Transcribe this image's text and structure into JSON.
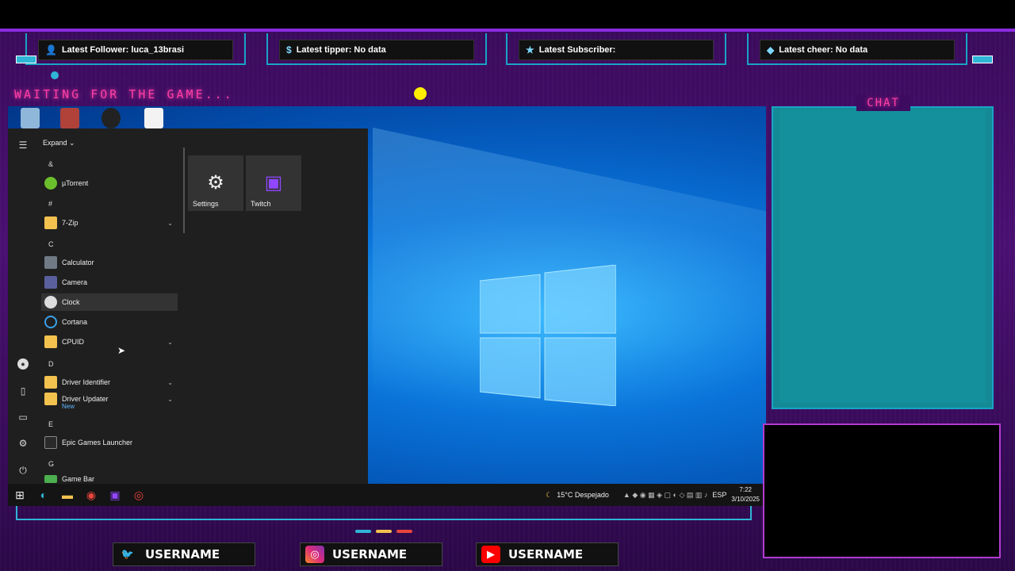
{
  "alerts": {
    "follower": "Latest Follower: luca_13brasi",
    "tipper": "Latest tipper: No data",
    "subscriber": "Latest Subscriber:",
    "cheer": "Latest cheer: No data"
  },
  "overlay": {
    "waiting_text": "WAITING FOR THE GAME...",
    "chat_title": "CHAT"
  },
  "start_menu": {
    "expand_label": "Expand",
    "sections": [
      {
        "letter": "&"
      },
      {
        "letter": "#"
      },
      {
        "letter": "C"
      },
      {
        "letter": "D"
      },
      {
        "letter": "E"
      },
      {
        "letter": "G"
      }
    ],
    "apps": [
      {
        "label": "µTorrent"
      },
      {
        "label": "7-Zip"
      },
      {
        "label": "Calculator"
      },
      {
        "label": "Camera"
      },
      {
        "label": "Clock"
      },
      {
        "label": "Cortana"
      },
      {
        "label": "CPUID"
      },
      {
        "label": "Driver Identifier"
      },
      {
        "label": "Driver Updater",
        "badge": "New"
      },
      {
        "label": "Epic Games Launcher"
      },
      {
        "label": "Game Bar"
      }
    ],
    "tiles": [
      {
        "label": "Settings",
        "icon": "gear-icon"
      },
      {
        "label": "Twitch",
        "icon": "twitch-icon"
      }
    ]
  },
  "taskbar": {
    "weather": "15°C  Despejado",
    "language": "ESP",
    "time": "7:22",
    "date": "3/10/2025"
  },
  "socials": [
    {
      "platform": "twitter",
      "username": "USERNAME"
    },
    {
      "platform": "instagram",
      "username": "USERNAME"
    },
    {
      "platform": "youtube",
      "username": "USERNAME"
    }
  ],
  "colors": {
    "accent_pink": "#ff3ea5",
    "accent_cyan": "#1aa3c6",
    "purple_bg": "#4a0f72"
  }
}
